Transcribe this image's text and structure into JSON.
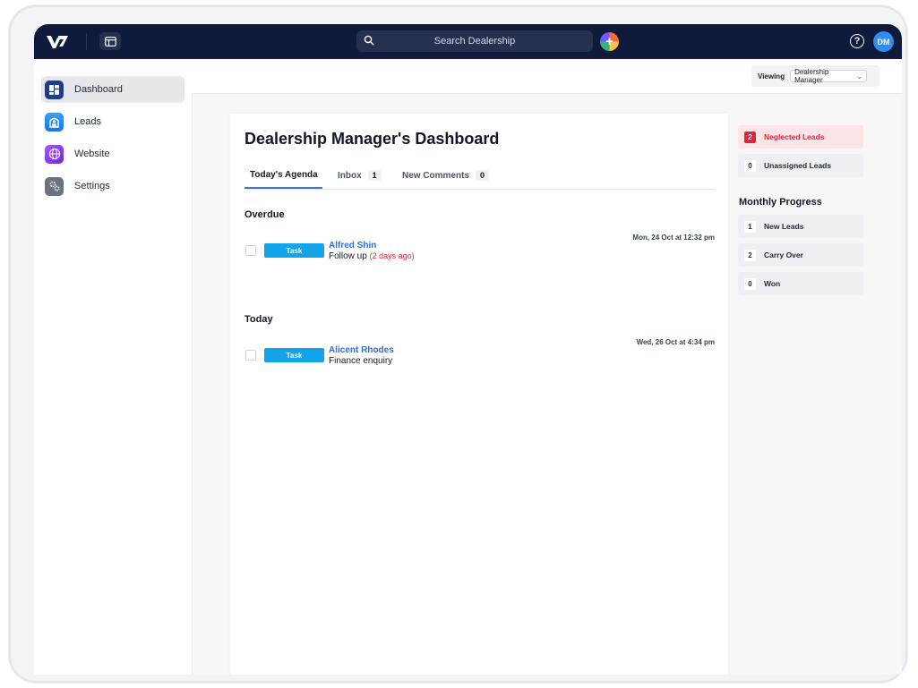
{
  "topbar": {
    "search_placeholder": "Search Dealership",
    "add_label": "+",
    "help_label": "?",
    "avatar_initials": "DM"
  },
  "sidebar": {
    "items": [
      {
        "label": "Dashboard",
        "icon": "dashboard-icon",
        "active": true
      },
      {
        "label": "Leads",
        "icon": "leads-icon"
      },
      {
        "label": "Website",
        "icon": "globe-icon"
      },
      {
        "label": "Settings",
        "icon": "gear-icon"
      }
    ]
  },
  "header": {
    "viewing_label": "Viewing",
    "viewing_value": "Dealership Manager"
  },
  "main": {
    "title": "Dealership Manager's Dashboard",
    "tabs": [
      {
        "label": "Today's Agenda"
      },
      {
        "label": "Inbox",
        "count": "1"
      },
      {
        "label": "New Comments",
        "count": "0"
      }
    ],
    "sections": [
      {
        "heading": "Overdue",
        "tasks": [
          {
            "badge": "Task",
            "name": "Alfred Shin",
            "desc": "Follow up",
            "ago": "(2 days ago)",
            "due": "Mon, 24 Oct at 12:32 pm"
          }
        ]
      },
      {
        "heading": "Today",
        "tasks": [
          {
            "badge": "Task",
            "name": "Alicent Rhodes",
            "desc": "Finance enquiry",
            "due": "Wed, 26 Oct at 4:34 pm"
          }
        ]
      }
    ]
  },
  "right_panel": {
    "alerts": [
      {
        "count": "2",
        "label": "Neglected Leads"
      },
      {
        "count": "0",
        "label": "Unassigned Leads"
      }
    ],
    "progress_title": "Monthly Progress",
    "progress": [
      {
        "count": "1",
        "label": "New Leads"
      },
      {
        "count": "2",
        "label": "Carry Over"
      },
      {
        "count": "0",
        "label": "Won"
      }
    ]
  },
  "colors": {
    "topbar_bg": "#0f1b3d",
    "accent_blue": "#2f6fe3",
    "task_badge": "#12a3e8",
    "alert_red": "#e0243a"
  }
}
